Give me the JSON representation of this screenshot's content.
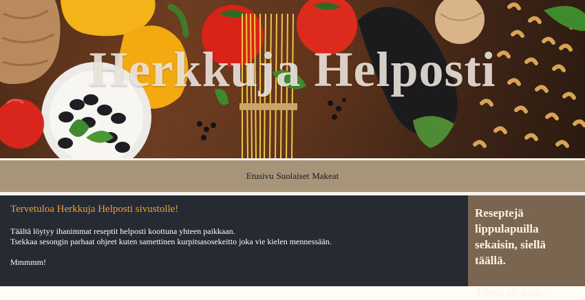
{
  "header": {
    "title": "Herkkuja Helposti",
    "image": "food-ingredients-background"
  },
  "nav": {
    "items": [
      {
        "label": "Etusivu"
      },
      {
        "label": "Suolaiset"
      },
      {
        "label": "Makeat"
      }
    ]
  },
  "main": {
    "heading": "Tervetuloa Herkkuja Helposti sivustolle!",
    "line1": "Täältä löytyy ihanimmat reseptit helposti koottuna yhteen paikkaan.",
    "line2": "Tsekkaa sesongin parhaat ohjeet kuten samettinen kurpitsasosekeitto joka vie kielen mennessään.",
    "line3": "Mmmmm!"
  },
  "aside": {
    "text1": "Reseptejä lippulapuilla sekaisin, siellä täällä.",
    "text2": "Tämä sivusto"
  },
  "colors": {
    "heading": "#f0a035",
    "nav_bg": "#a89479",
    "main_bg": "#252a33",
    "aside_bg": "#7a6650"
  }
}
